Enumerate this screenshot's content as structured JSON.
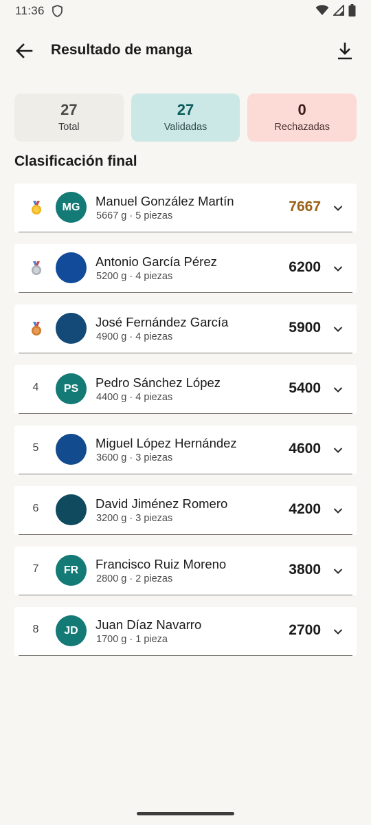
{
  "status_bar": {
    "time": "11:36",
    "icons": [
      "shield-icon",
      "wifi-icon",
      "signal-icon",
      "battery-icon"
    ]
  },
  "app_bar": {
    "title": "Resultado de manga",
    "back_icon": "arrow-back-icon",
    "action_icon": "download-icon"
  },
  "stats": {
    "total": {
      "value": "27",
      "label": "Total"
    },
    "validated": {
      "value": "27",
      "label": "Validadas"
    },
    "rejected": {
      "value": "0",
      "label": "Rechazadas"
    }
  },
  "section_title": "Clasificación final",
  "standings": [
    {
      "rank": "1",
      "medal": "gold-medal-icon",
      "initials": "MG",
      "avatar_color": "#137a76",
      "name": "Manuel González Martín",
      "detail": "5667 g · 5 piezas",
      "score": "7667"
    },
    {
      "rank": "2",
      "medal": "silver-medal-icon",
      "initials": "",
      "avatar_color": "#114b9a",
      "name": "Antonio García Pérez",
      "detail": "5200 g · 4 piezas",
      "score": "6200"
    },
    {
      "rank": "3",
      "medal": "bronze-medal-icon",
      "initials": "",
      "avatar_color": "#134a78",
      "name": "José Fernández García",
      "detail": "4900 g · 4 piezas",
      "score": "5900"
    },
    {
      "rank": "4",
      "medal": "",
      "initials": "PS",
      "avatar_color": "#137a76",
      "name": "Pedro Sánchez López",
      "detail": "4400 g · 4 piezas",
      "score": "5400"
    },
    {
      "rank": "5",
      "medal": "",
      "initials": "",
      "avatar_color": "#124b8e",
      "name": "Miguel López Hernández",
      "detail": "3600 g · 3 piezas",
      "score": "4600"
    },
    {
      "rank": "6",
      "medal": "",
      "initials": "",
      "avatar_color": "#0f4a5e",
      "name": "David Jiménez Romero",
      "detail": "3200 g · 3 piezas",
      "score": "4200"
    },
    {
      "rank": "7",
      "medal": "",
      "initials": "FR",
      "avatar_color": "#137a76",
      "name": "Francisco Ruiz Moreno",
      "detail": "2800 g · 2 piezas",
      "score": "3800"
    },
    {
      "rank": "8",
      "medal": "",
      "initials": "JD",
      "avatar_color": "#137a76",
      "name": "Juan Díaz Navarro",
      "detail": "1700 g · 1 pieza",
      "score": "2700"
    }
  ],
  "colors": {
    "background": "#f8f6f2",
    "gold_score": "#9a5f16",
    "validated_bg": "#cce8e6",
    "rejected_bg": "#fcdad6",
    "total_bg": "#efede8"
  }
}
